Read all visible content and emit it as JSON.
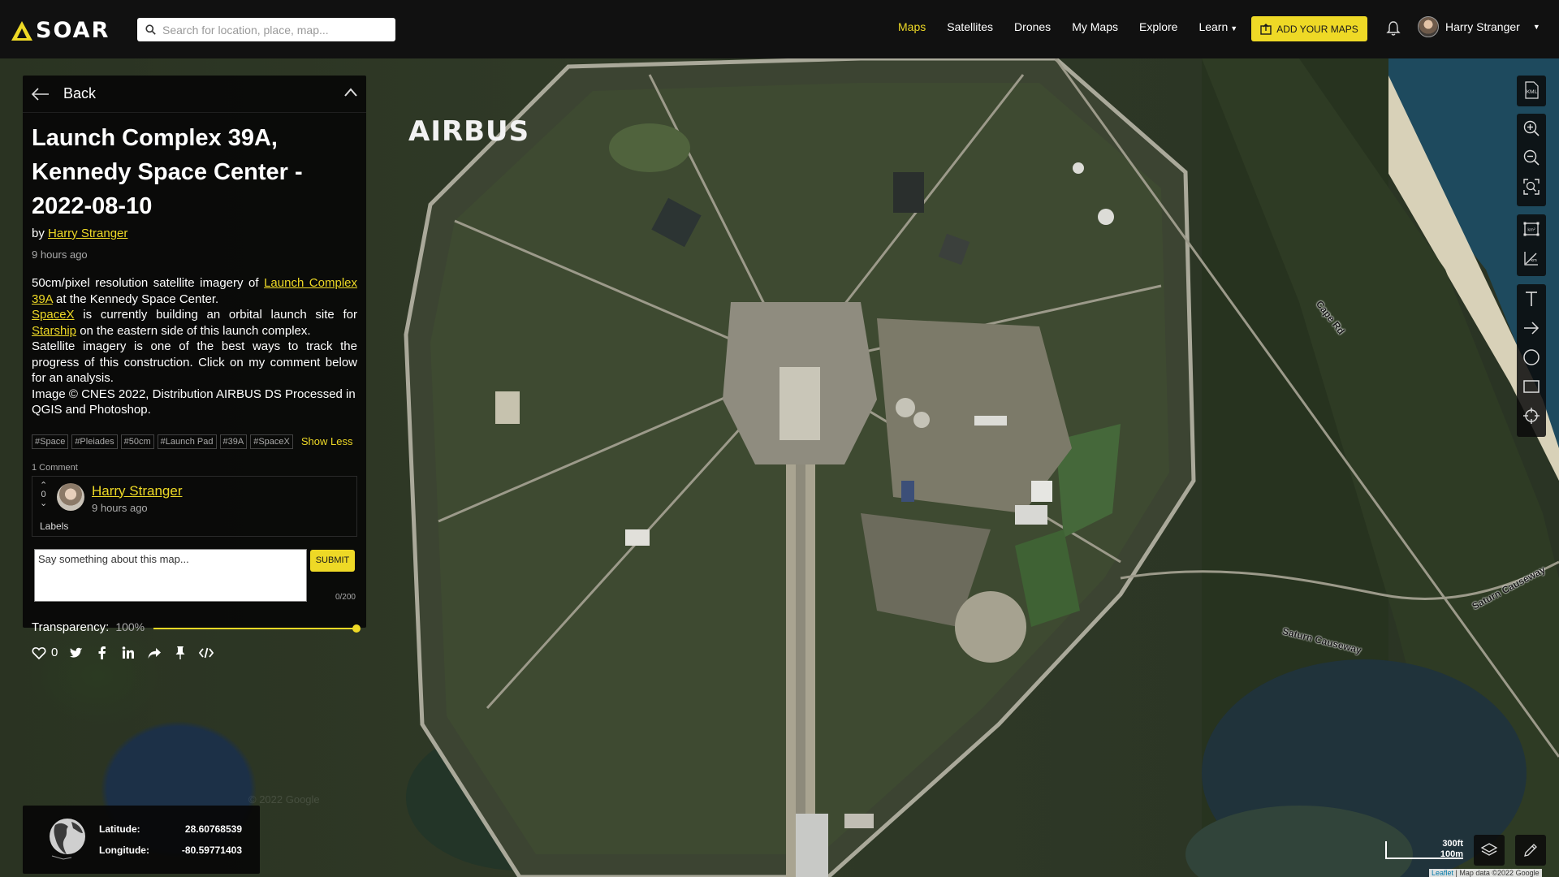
{
  "header": {
    "logo_text": "SOAR",
    "search_placeholder": "Search for location, place, map...",
    "nav": [
      {
        "label": "Maps",
        "active": true
      },
      {
        "label": "Satellites"
      },
      {
        "label": "Drones"
      },
      {
        "label": "My Maps"
      },
      {
        "label": "Explore"
      },
      {
        "label": "Learn",
        "has_dropdown": true
      }
    ],
    "add_maps_label": "ADD YOUR MAPS",
    "user_name": "Harry Stranger"
  },
  "panel": {
    "back_label": "Back",
    "title": "Launch Complex 39A, Kennedy Space Center - 2022-08-10",
    "by_prefix": "by",
    "author": "Harry Stranger",
    "time_ago": "9 hours ago",
    "description": {
      "p1_text": "50cm/pixel resolution satellite imagery of",
      "p1_link": "Launch Complex 39A",
      "p1_after": "at the Kennedy Space Center.",
      "p2_link1": "SpaceX",
      "p2_mid": "is currently building an orbital launch site for",
      "p2_link2": "Starship",
      "p2_after": "on the eastern side of this launch complex.",
      "p3": "Satellite imagery is one of the best ways to track the progress of this construction. Click on my comment below for an analysis.",
      "p4": "Image © CNES 2022, Distribution AIRBUS DS Processed in QGIS and Photoshop."
    },
    "tags": [
      "#Space",
      "#Pleiades",
      "#50cm",
      "#Launch Pad",
      "#39A",
      "#SpaceX"
    ],
    "show_less_label": "Show Less",
    "comment_count_label": "1 Comment",
    "comment": {
      "votes": "0",
      "author": "Harry Stranger",
      "time_ago": "9 hours ago",
      "labels": "Labels"
    },
    "comment_placeholder": "Say something about this map...",
    "submit_label": "SUBMIT",
    "char_counter": "0/200",
    "transparency_label": "Transparency:",
    "transparency_value": "100%",
    "transparency_level": 1.0,
    "likes": "0"
  },
  "map": {
    "watermark": "AIRBUS",
    "google_watermark": "© 2022 Google",
    "road_labels": [
      "Cape Rd",
      "Saturn Causeway",
      "Saturn Causeway"
    ],
    "coordinates": {
      "lat_label": "Latitude:",
      "lat_value": "28.60768539",
      "lng_label": "Longitude:",
      "lng_value": "-80.59771403"
    },
    "scale": {
      "imperial": "300ft",
      "metric": "100m"
    },
    "attribution_leaflet": "Leaflet",
    "attribution_text": "| Map data ©2022 Google",
    "kml_label": "KML",
    "toolbar_icons": [
      "kml-icon",
      "zoom-in-icon",
      "zoom-out-icon",
      "zoom-extent-icon",
      "area-measure-icon",
      "distance-measure-icon",
      "text-tool-icon",
      "arrow-tool-icon",
      "circle-tool-icon",
      "rectangle-tool-icon",
      "crosshair-icon"
    ]
  },
  "colors": {
    "accent": "#eed926",
    "panel_bg": "#080808",
    "topbar_bg": "#111111"
  }
}
